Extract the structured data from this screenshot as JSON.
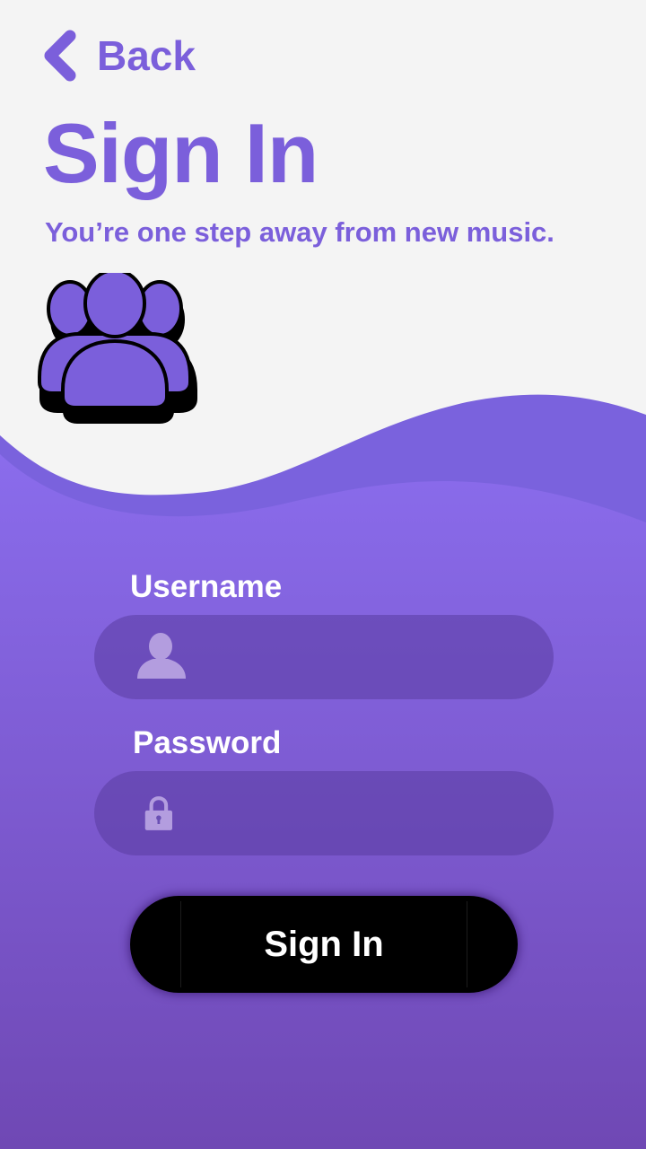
{
  "header": {
    "back_label": "Back",
    "title": "Sign In",
    "subtitle": "You’re one step away from new music."
  },
  "form": {
    "username": {
      "label": "Username",
      "value": "",
      "icon": "user-icon"
    },
    "password": {
      "label": "Password",
      "value": "",
      "icon": "lock-icon"
    },
    "submit_label": "Sign In"
  },
  "colors": {
    "accent": "#7b5fdb",
    "background_top": "#f4f4f4",
    "gradient_start": "#8a6cec",
    "gradient_end": "#6f48b4",
    "field_fill": "#6a50b4",
    "button": "#000000"
  },
  "icons": {
    "back": "chevron-left-icon",
    "hero": "users-group-icon"
  }
}
